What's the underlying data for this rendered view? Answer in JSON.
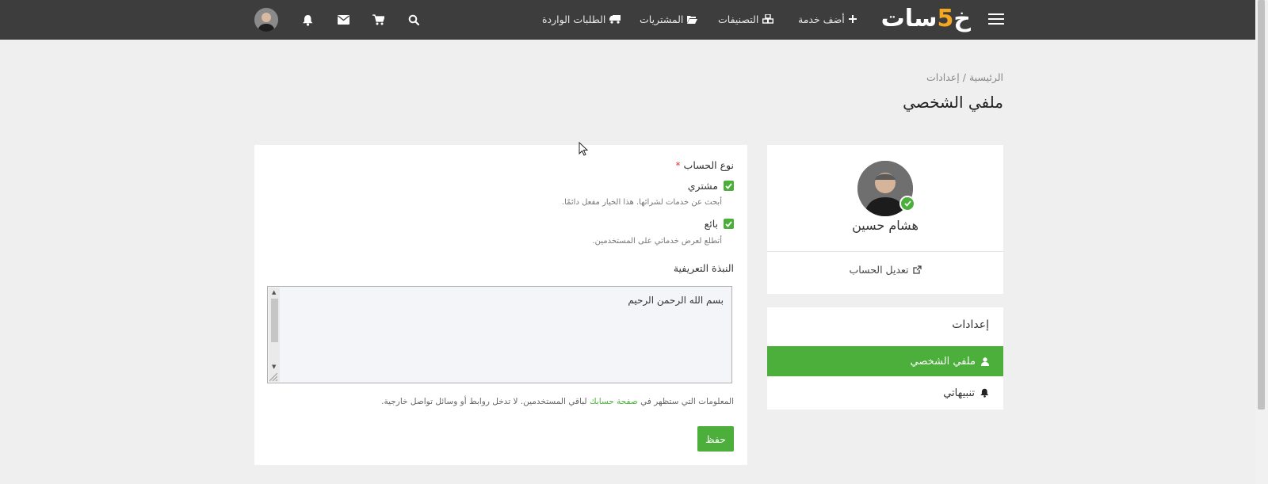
{
  "nav": {
    "logo": {
      "part1": "خ",
      "five": "5",
      "part2": "سات"
    },
    "items": [
      {
        "icon": "plus-icon",
        "label": "أضف خدمة"
      },
      {
        "icon": "cubes-icon",
        "label": "التصنيفات"
      },
      {
        "icon": "folder-open-icon",
        "label": "المشتريات"
      },
      {
        "icon": "truck-icon",
        "label": "الطلبات الواردة"
      }
    ],
    "icons": [
      "search-icon",
      "cart-icon",
      "envelope-icon",
      "bell-icon"
    ]
  },
  "breadcrumb": {
    "home": "الرئيسية",
    "separator": "/",
    "current": "إعدادات"
  },
  "page_title": "ملفي الشخصي",
  "profile": {
    "name": "هشام حسين",
    "edit_label": "تعديل الحساب"
  },
  "settings_menu": {
    "title": "إعدادات",
    "items": [
      {
        "label": "ملفي الشخصي",
        "icon": "user-icon",
        "active": true
      },
      {
        "label": "تنبيهاتي",
        "icon": "bell-icon",
        "active": false
      }
    ]
  },
  "form": {
    "account_type_label": "نوع الحساب",
    "required_mark": "*",
    "buyer": {
      "label": "مشتري",
      "checked": true,
      "help": "أبحث عن خدمات لشرائها. هذا الخيار مفعل دائمًا."
    },
    "seller": {
      "label": "بائع",
      "checked": true,
      "help": "أتطلع لعرض خدماتي على المستخدمين."
    },
    "bio_label": "النبذة التعريفية",
    "bio_value": "بسم الله الرحمن الرحيم",
    "note_before": "المعلومات التي ستظهر في",
    "note_link": "صفحة حسابك",
    "note_after": "لباقي المستخدمين. لا تدخل روابط أو وسائل تواصل خارجية.",
    "save_label": "حفظ"
  },
  "colors": {
    "accent": "#4caf3c",
    "topbar": "#3d3d3d",
    "brand_five": "#f5a81f",
    "background": "#efefef"
  }
}
